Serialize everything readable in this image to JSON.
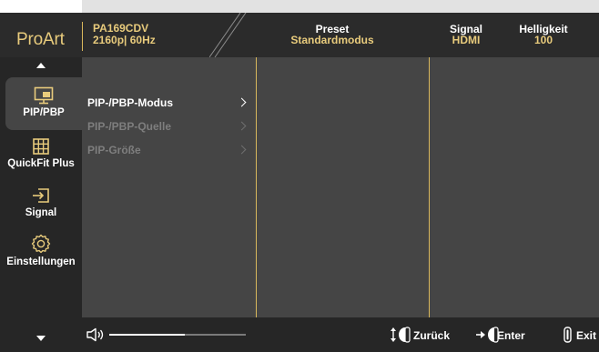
{
  "header": {
    "logo": "ProArt",
    "model": "PA169CDV",
    "resolution": "2160p| 60Hz",
    "preset": {
      "label": "Preset",
      "value": "Standardmodus"
    },
    "signal": {
      "label": "Signal",
      "value": "HDMI"
    },
    "brightness": {
      "label": "Helligkeit",
      "value": "100"
    }
  },
  "sidebar": {
    "items": [
      {
        "label": "PIP/PBP",
        "icon": "pip-monitor-icon",
        "active": true
      },
      {
        "label": "QuickFit Plus",
        "icon": "grid-icon",
        "active": false
      },
      {
        "label": "Signal",
        "icon": "input-signal-icon",
        "active": false
      },
      {
        "label": "Einstellungen",
        "icon": "gear-icon",
        "active": false
      }
    ]
  },
  "menu": {
    "items": [
      {
        "label": "PIP-/PBP-Modus",
        "enabled": true
      },
      {
        "label": "PIP-/PBP-Quelle",
        "enabled": false
      },
      {
        "label": "PIP-Größe",
        "enabled": false
      }
    ]
  },
  "footer": {
    "volume": 0.55,
    "back_label": "Zurück",
    "enter_label": "Enter",
    "exit_label": "Exit"
  },
  "colors": {
    "accent": "#e8cb7c",
    "panel": "#454545",
    "dark": "#262626",
    "header": "#2b2b2b"
  }
}
